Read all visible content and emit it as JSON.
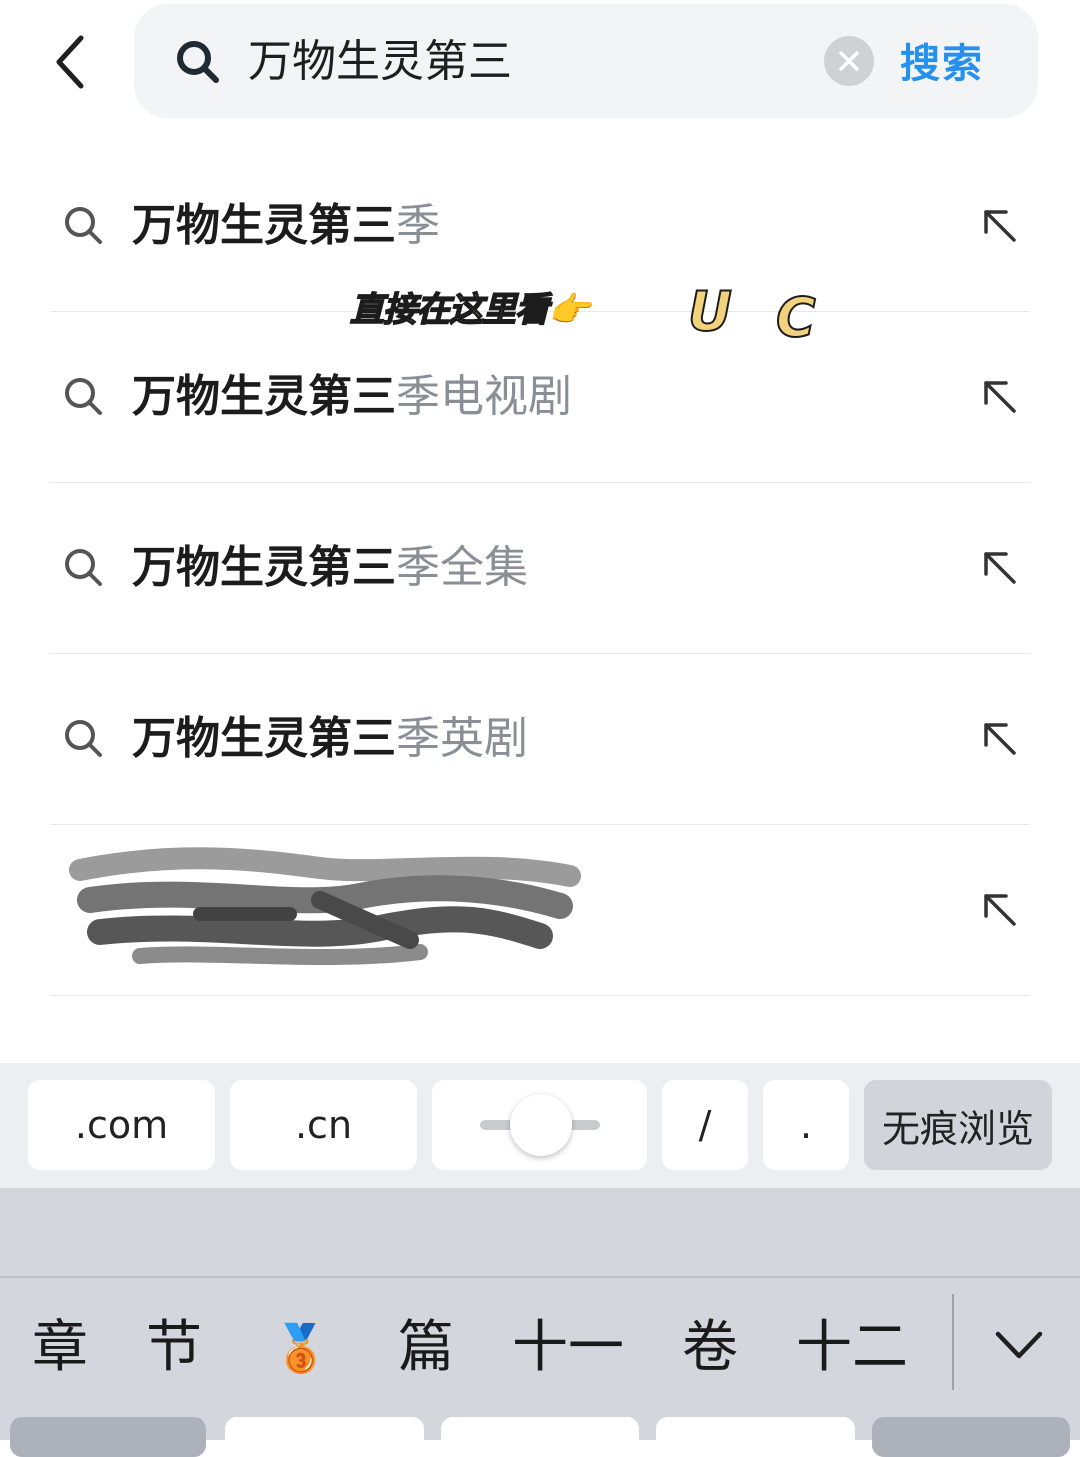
{
  "search": {
    "query": "万物生灵第三",
    "submit_label": "搜索"
  },
  "suggestions": [
    {
      "match": "万物生灵第三",
      "rest": "季"
    },
    {
      "match": "万物生灵第三",
      "rest": "季电视剧"
    },
    {
      "match": "万物生灵第三",
      "rest": "季全集"
    },
    {
      "match": "万物生灵第三",
      "rest": "季英剧"
    }
  ],
  "overlay": {
    "caption": "直接在这里看👉",
    "letter_u": "U",
    "letter_c": "C"
  },
  "accessory": {
    "com": ".com",
    "cn": ".cn",
    "slash": "/",
    "dot": ".",
    "incognito": "无痕浏览"
  },
  "candidates": {
    "c1": "章",
    "c2": "节",
    "c3": "🥉",
    "c4": "篇",
    "c5": "十一",
    "c6": "卷",
    "c7": "十二"
  },
  "colors": {
    "accent": "#2590ee",
    "muted_text": "#8a8f96",
    "search_bg": "#f2f4f6",
    "keyboard_bg": "#d3d6dd"
  }
}
